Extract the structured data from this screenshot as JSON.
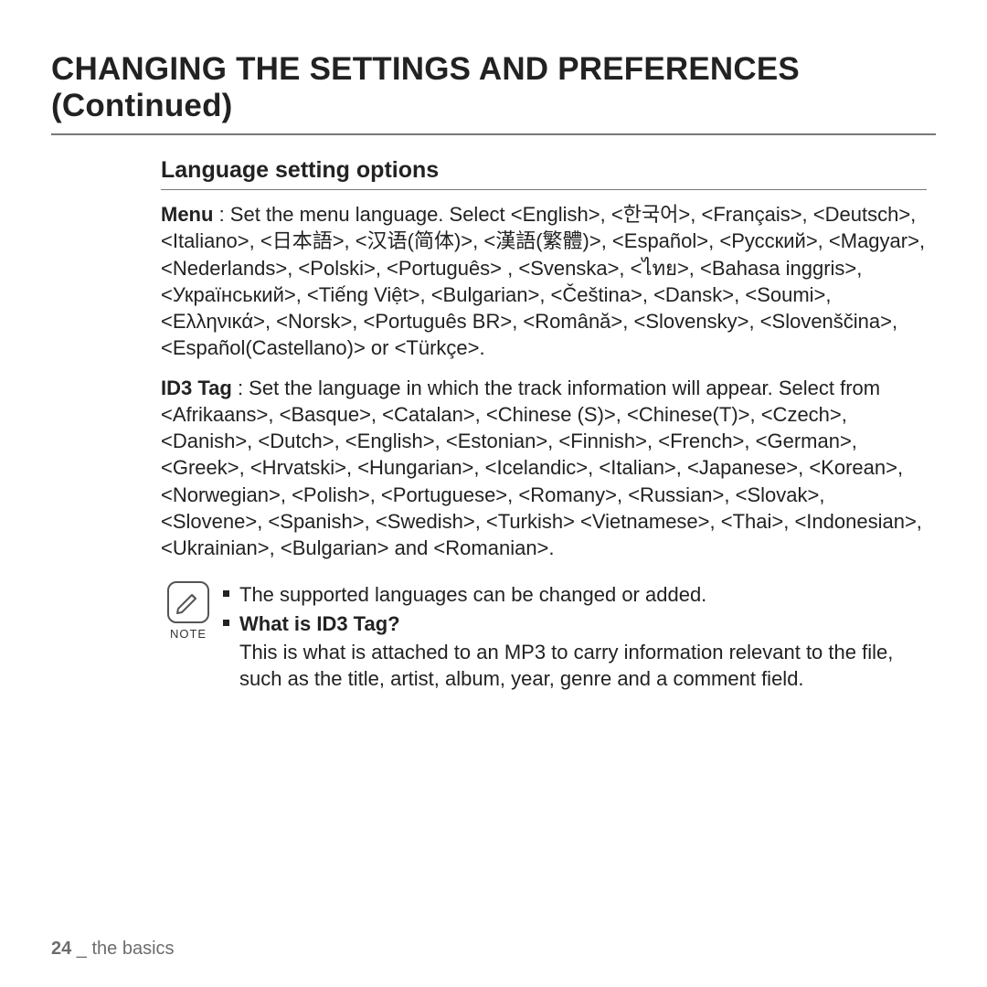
{
  "title": "CHANGING THE SETTINGS AND PREFERENCES (Continued)",
  "subheading": "Language setting options",
  "menu_label": "Menu",
  "menu_body": " : Set the menu language. Select <English>, <한국어>, <Français>, <Deutsch>, <Italiano>, <日本語>, <汉语(简体)>, <漢語(繁體)>, <Español>, <Русский>, <Magyar>, <Nederlands>, <Polski>, <Português> , <Svenska>, <ไทย>, <Bahasa inggris>, <Український>, <Tiếng Việt>, <Bulgarian>, <Čeština>, <Dansk>, <Soumi>, <Ελληνικά>, <Norsk>, <Português BR>, <Română>, <Slovensky>, <Slovenščina>, <Español(Castellano)> or <Türkçe>.",
  "id3_label": "ID3 Tag",
  "id3_body": " : Set the language in which the track information will appear.\nSelect from <Afrikaans>, <Basque>, <Catalan>, <Chinese (S)>, <Chinese(T)>, <Czech>, <Danish>, <Dutch>, <English>, <Estonian>, <Finnish>, <French>, <German>, <Greek>, <Hrvatski>, <Hungarian>, <Icelandic>, <Italian>, <Japanese>, <Korean>, <Norwegian>, <Polish>, <Portuguese>, <Romany>, <Russian>, <Slovak>, <Slovene>, <Spanish>, <Swedish>, <Turkish> <Vietnamese>, <Thai>, <Indonesian>, <Ukrainian>, <Bulgarian> and <Romanian>.",
  "note_label": "NOTE",
  "note_bullet1": "The supported languages can be changed or added.",
  "note_question": "What is ID3 Tag?",
  "note_answer": "This is what is attached to an MP3 to carry information relevant to the file, such as the title, artist, album, year, genre and a comment field.",
  "footer_page": "24",
  "footer_sep": " _ ",
  "footer_section": "the basics"
}
